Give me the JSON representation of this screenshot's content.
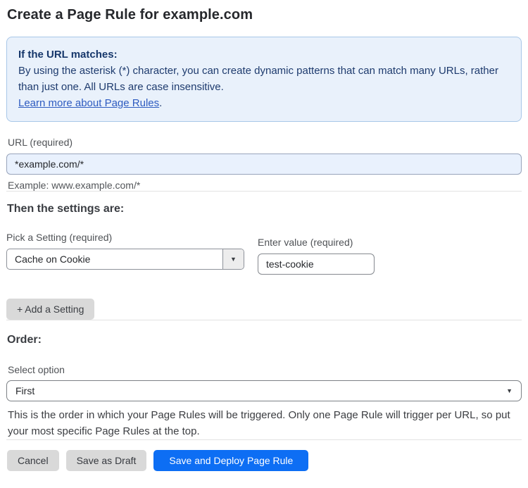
{
  "page": {
    "title": "Create a Page Rule for example.com"
  },
  "info_box": {
    "heading": "If the URL matches:",
    "body": "By using the asterisk (*) character, you can create dynamic patterns that can match many URLs, rather than just one. All URLs are case insensitive.",
    "link_label": "Learn more about Page Rules",
    "link_suffix": "."
  },
  "url_field": {
    "label": "URL (required)",
    "value": "*example.com/*",
    "helper": "Example: www.example.com/*"
  },
  "settings": {
    "heading": "Then the settings are:",
    "setting_label": "Pick a Setting (required)",
    "setting_value": "Cache on Cookie",
    "value_label": "Enter value (required)",
    "value_value": "test-cookie",
    "add_button_label": "+ Add a Setting",
    "dropdown_arrow": "▼"
  },
  "order": {
    "heading": "Order:",
    "select_label": "Select option",
    "selected_option": "First",
    "dropdown_arrow": "▼",
    "helper": "This is the order in which your Page Rules will be triggered. Only one Page Rule will trigger per URL, so put your most specific Page Rules at the top."
  },
  "actions": {
    "cancel_label": "Cancel",
    "save_draft_label": "Save as Draft",
    "deploy_label": "Save and Deploy Page Rule"
  },
  "colors": {
    "accent_blue": "#0d6ef4",
    "info_box_bg": "#e9f1fb",
    "info_box_border": "#a8c7e8",
    "info_text": "#1e3b6e",
    "link_blue": "#2d5bc0",
    "url_input_bg": "#e9f1fd",
    "gray_button_bg": "#d9d9d9"
  }
}
